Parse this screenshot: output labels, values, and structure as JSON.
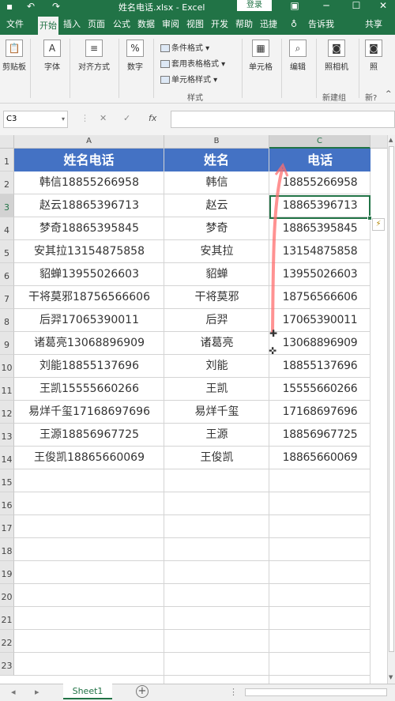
{
  "titlebar": {
    "title": "姓名电话.xlsx  -  Excel",
    "login": "登录",
    "save_icon": "save-icon",
    "undo_icon": "undo-icon",
    "redo_icon": "redo-icon",
    "restore_icon": "restore-window-icon",
    "minimize_icon": "minimize-icon",
    "maximize_icon": "maximize-icon",
    "close_icon": "close-icon"
  },
  "ribbon_tabs": [
    "文件",
    "开始",
    "插入",
    "页面",
    "公式",
    "数据",
    "审阅",
    "视图",
    "开发",
    "帮助",
    "迅捷"
  ],
  "tell_me": "告诉我",
  "share": "共享",
  "ribbon": {
    "clipboard": "剪贴板",
    "font": "字体",
    "alignment": "对齐方式",
    "number": "数字",
    "cond_format": "条件格式",
    "table_format": "套用表格格式",
    "cell_style": "单元格样式",
    "styles_group": "样式",
    "cells": "单元格",
    "editing": "编辑",
    "camera": "照相机",
    "new_group": "新建组",
    "camera2": "照",
    "new_group2": "新?"
  },
  "formula_bar": {
    "name_box": "C3",
    "fx": "fx",
    "content": ""
  },
  "grid": {
    "columns": [
      "A",
      "B",
      "C"
    ],
    "rows": [
      "1",
      "2",
      "3",
      "4",
      "5",
      "6",
      "7",
      "8",
      "9",
      "10",
      "11",
      "12",
      "13",
      "14",
      "15",
      "16",
      "17",
      "18",
      "19",
      "20",
      "21",
      "22",
      "23"
    ],
    "header": [
      "姓名电话",
      "姓名",
      "电话"
    ],
    "data": [
      [
        "韩信18855266958",
        "韩信",
        "18855266958"
      ],
      [
        "赵云18865396713",
        "赵云",
        "18865396713"
      ],
      [
        "梦奇18865395845",
        "梦奇",
        "18865395845"
      ],
      [
        "安其拉13154875858",
        "安其拉",
        "13154875858"
      ],
      [
        "貂蝉13955026603",
        "貂蝉",
        "13955026603"
      ],
      [
        "干将莫邪18756566606",
        "干将莫邪",
        "18756566606"
      ],
      [
        "后羿17065390011",
        "后羿",
        "17065390011"
      ],
      [
        "诸葛亮13068896909",
        "诸葛亮",
        "13068896909"
      ],
      [
        "刘能18855137696",
        "刘能",
        "18855137696"
      ],
      [
        "王凯15555660266",
        "王凯",
        "15555660266"
      ],
      [
        "易烊千玺17168697696",
        "易烊千玺",
        "17168697696"
      ],
      [
        "王源18856967725",
        "王源",
        "18856967725"
      ],
      [
        "王俊凯18865660069",
        "王俊凯",
        "18865660069"
      ]
    ],
    "selected_cell": "C3",
    "header_color": "#4472c4"
  },
  "sheets": [
    "Sheet1"
  ],
  "colors": {
    "accent": "#217346",
    "annotation": "#ff5050"
  }
}
